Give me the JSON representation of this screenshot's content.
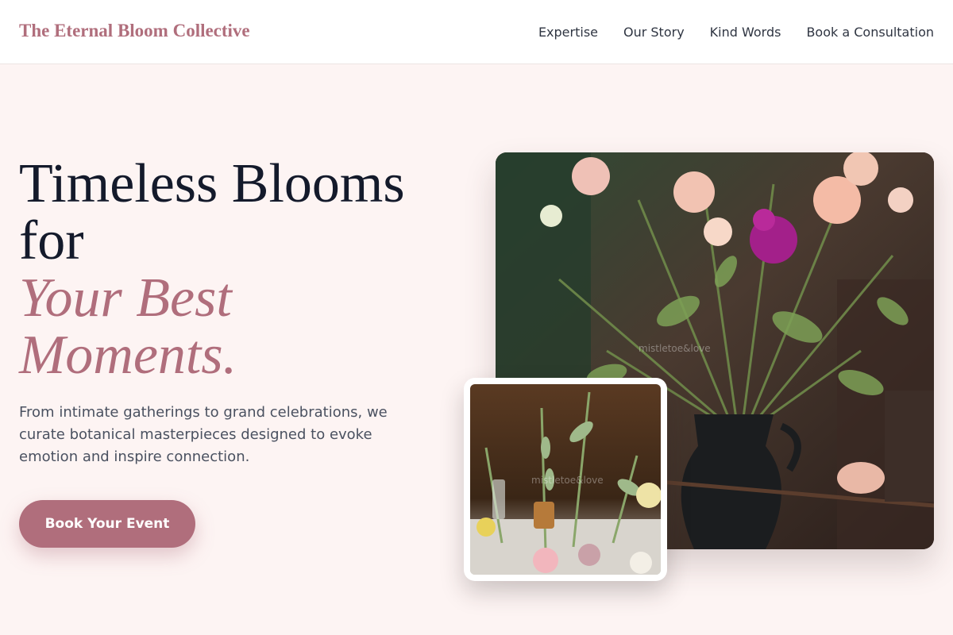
{
  "brand": {
    "name": "The Eternal Bloom Collective",
    "accent_color": "#b06e7c",
    "background_color": "#fdf4f3"
  },
  "nav": {
    "links": [
      "Expertise",
      "Our Story",
      "Kind Words",
      "Book a Consultation"
    ]
  },
  "hero": {
    "headline_line1": "Timeless Blooms",
    "headline_line2": "for",
    "headline_accent_line1": "Your Best",
    "headline_accent_line2": "Moments.",
    "subtext": "From intimate gatherings to grand celebrations, we curate botanical masterpieces designed to evoke emotion and inspire connection.",
    "cta_label": "Book Your Event"
  },
  "images": {
    "main_photo": "flower-arrangement-photo",
    "small_photo": "table-florals-photo",
    "small_photo_watermark": "mistletoe&love"
  }
}
